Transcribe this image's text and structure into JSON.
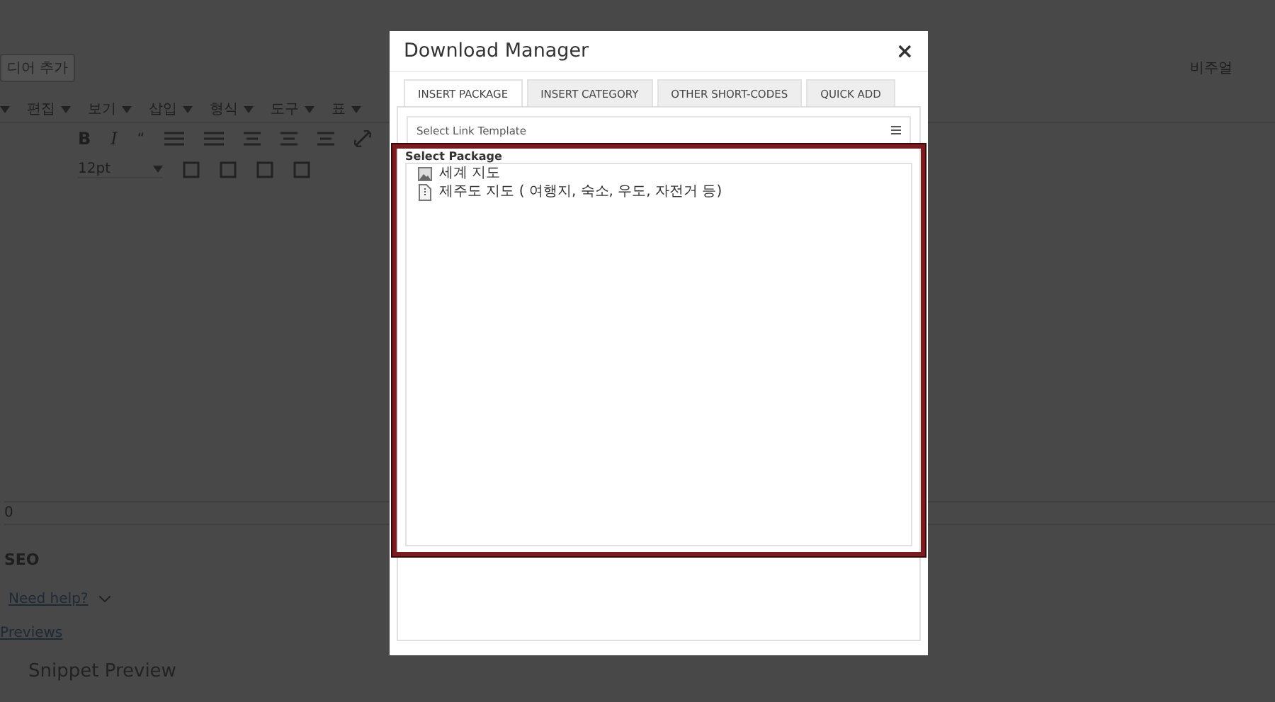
{
  "editor": {
    "add_media_button": "디어 추가",
    "visual_tab": "비주얼",
    "menus": [
      "편집",
      "보기",
      "삽입",
      "형식",
      "도구",
      "표"
    ],
    "format_buttons": [
      "B",
      "I",
      "“"
    ],
    "font_size": "12pt",
    "word_count": "0",
    "seo_title": "SEO",
    "help_link": "Need help?",
    "previews_link": "Previews",
    "snippet_preview": "Snippet Preview"
  },
  "dialog": {
    "title": "Download Manager",
    "close": "×",
    "tabs": [
      {
        "label": "INSERT PACKAGE",
        "selected": true
      },
      {
        "label": "INSERT CATEGORY",
        "selected": false
      },
      {
        "label": "OTHER SHORT-CODES",
        "selected": false
      },
      {
        "label": "QUICK ADD",
        "selected": false
      }
    ],
    "link_template": {
      "placeholder": "Select Link Template"
    },
    "package_label": "Select Package",
    "packages": [
      {
        "name": "세계 지도",
        "kind": "image"
      },
      {
        "name": "제주도 지도 ( 여행지, 숙소, 우도, 자전거 등)",
        "kind": "file"
      }
    ]
  }
}
